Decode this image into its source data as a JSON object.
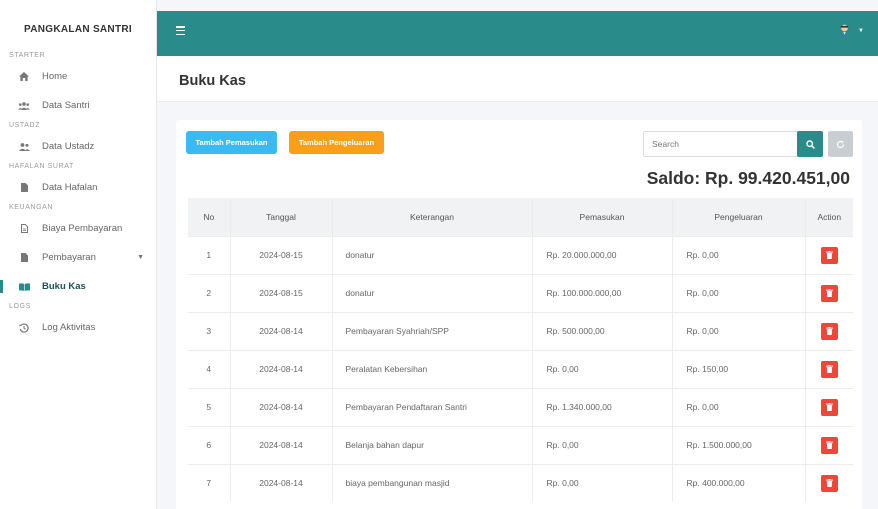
{
  "brand": "PANGKALAN SANTRI",
  "sidebar": {
    "sections": [
      {
        "title": "STARTER",
        "items": [
          {
            "label": "Home",
            "icon": "home-icon"
          },
          {
            "label": "Data Santri",
            "icon": "users-icon"
          }
        ]
      },
      {
        "title": "USTADZ",
        "items": [
          {
            "label": "Data Ustadz",
            "icon": "user-group-icon"
          }
        ]
      },
      {
        "title": "HAFALAN SURAT",
        "items": [
          {
            "label": "Data Hafalan",
            "icon": "file-icon"
          }
        ]
      },
      {
        "title": "KEUANGAN",
        "items": [
          {
            "label": "Biaya Pembayaran",
            "icon": "file-outline-icon"
          },
          {
            "label": "Pembayaran",
            "icon": "file-icon"
          },
          {
            "label": "Buku Kas",
            "icon": "book-open-icon",
            "active": true
          }
        ]
      },
      {
        "title": "LOGS",
        "items": [
          {
            "label": "Log Aktivitas",
            "icon": "history-icon"
          }
        ]
      }
    ]
  },
  "colors": {
    "accent": "#2a8c8a",
    "info": "#3abaf0",
    "warning": "#f99f1b",
    "danger": "#f0453a"
  },
  "page": {
    "title": "Buku Kas"
  },
  "toolbar": {
    "add_income_label": "Tambah Pemasukan",
    "add_expense_label": "Tambah Pengeluaran",
    "search_placeholder": "Search"
  },
  "saldo": "Saldo: Rp. 99.420.451,00",
  "table": {
    "headers": {
      "no": "No",
      "tanggal": "Tanggal",
      "keterangan": "Keterangan",
      "pemasukan": "Pemasukan",
      "pengeluaran": "Pengeluaran",
      "action": "Action"
    },
    "rows": [
      {
        "no": "1",
        "tanggal": "2024-08-15",
        "keterangan": "donatur",
        "pemasukan": "Rp. 20.000.000,00",
        "pengeluaran": "Rp. 0,00"
      },
      {
        "no": "2",
        "tanggal": "2024-08-15",
        "keterangan": "donatur",
        "pemasukan": "Rp. 100.000.000,00",
        "pengeluaran": "Rp. 0,00"
      },
      {
        "no": "3",
        "tanggal": "2024-08-14",
        "keterangan": "Pembayaran Syahriah/SPP",
        "pemasukan": "Rp. 500.000,00",
        "pengeluaran": "Rp. 0,00"
      },
      {
        "no": "4",
        "tanggal": "2024-08-14",
        "keterangan": "Peralatan Kebersihan",
        "pemasukan": "Rp. 0,00",
        "pengeluaran": "Rp. 150,00"
      },
      {
        "no": "5",
        "tanggal": "2024-08-14",
        "keterangan": "Pembayaran Pendaftaran Santri",
        "pemasukan": "Rp. 1.340.000,00",
        "pengeluaran": "Rp. 0,00"
      },
      {
        "no": "6",
        "tanggal": "2024-08-14",
        "keterangan": "Belanja bahan dapur",
        "pemasukan": "Rp. 0,00",
        "pengeluaran": "Rp. 1.500.000,00"
      },
      {
        "no": "7",
        "tanggal": "2024-08-14",
        "keterangan": "biaya pembangunan masjid",
        "pemasukan": "Rp. 0,00",
        "pengeluaran": "Rp. 400.000,00"
      }
    ]
  }
}
